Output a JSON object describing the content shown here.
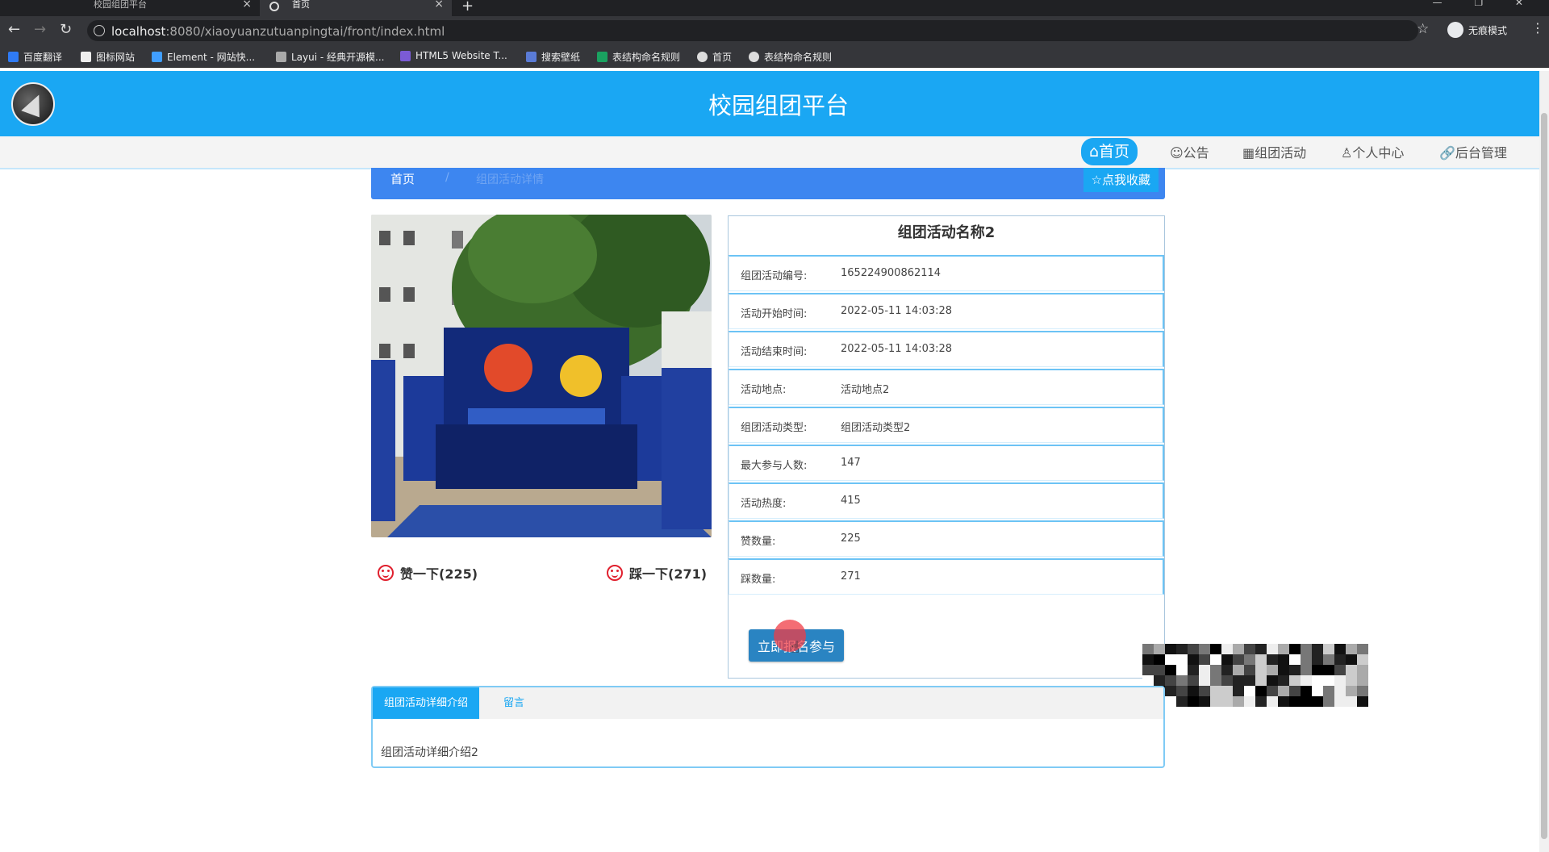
{
  "browser": {
    "tabs": [
      {
        "title": "校园组团平台",
        "close": "×"
      },
      {
        "title": "首页",
        "close": "×"
      }
    ],
    "new_tab": "+",
    "window_controls": "— ❐ ✕",
    "url_host": "localhost",
    "url_rest": ":8080/xiaoyuanzutuanpingtai/front/index.html",
    "incognito_label": "无痕模式",
    "bookmarks": [
      "百度翻译",
      "图标网站",
      "Element - 网站快...",
      "Layui - 经典开源模...",
      "HTML5 Website T...",
      "搜索壁纸",
      "表结构命名规则",
      "首页",
      "表结构命名规则"
    ],
    "colors": {
      "chrome": "#35363a",
      "tabstrip": "#202124"
    }
  },
  "header": {
    "site_title": "校园组团平台",
    "color": "#1aa7f3"
  },
  "nav": {
    "items": [
      "⌂首页",
      "☺公告",
      "▦组团活动",
      "♙个人中心",
      "🔗后台管理"
    ]
  },
  "breadcrumb": {
    "home": "首页",
    "separator": "/",
    "current": "组团活动详情",
    "favorite": "☆点我收藏"
  },
  "votes": {
    "like": "赞一下(225)",
    "dislike": "踩一下(271)"
  },
  "detail": {
    "title": "组团活动名称2",
    "rows": [
      {
        "key": "组团活动编号:",
        "value": "165224900862114"
      },
      {
        "key": "活动开始时间:",
        "value": "2022-05-11 14:03:28"
      },
      {
        "key": "活动结束时间:",
        "value": "2022-05-11 14:03:28"
      },
      {
        "key": "活动地点:",
        "value": "活动地点2"
      },
      {
        "key": "组团活动类型:",
        "value": "组团活动类型2"
      },
      {
        "key": "最大参与人数:",
        "value": "147"
      },
      {
        "key": "活动热度:",
        "value": "415"
      },
      {
        "key": "赞数量:",
        "value": "225"
      },
      {
        "key": "踩数量:",
        "value": "271"
      }
    ],
    "join_button": "立即报名参与"
  },
  "tabs": {
    "detail_label": "组团活动详细介绍",
    "message_label": "留言",
    "content": "组团活动详细介绍2"
  }
}
